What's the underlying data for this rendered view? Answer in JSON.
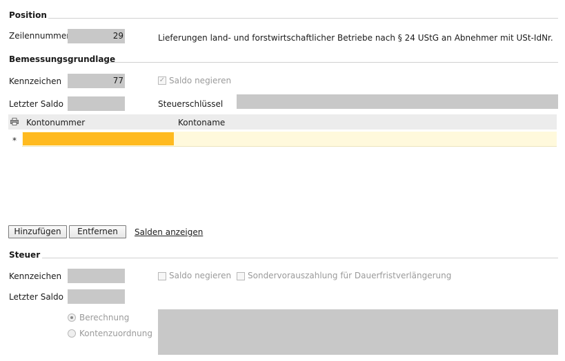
{
  "position": {
    "title": "Position",
    "zeilennummer_label": "Zeilennummer",
    "zeilennummer_value": "29",
    "description": "Lieferungen land- und forstwirtschaftlicher Betriebe nach § 24 UStG an Abnehmer mit USt-IdNr."
  },
  "bemessung": {
    "title": "Bemessungsgrundlage",
    "kennzeichen_label": "Kennzeichen",
    "kennzeichen_value": "77",
    "saldo_negieren_label": "Saldo negieren",
    "saldo_negieren_checked": true,
    "letzter_saldo_label": "Letzter Saldo",
    "letzter_saldo_value": "",
    "steuerschluessel_label": "Steuerschlüssel",
    "steuerschluessel_value": "",
    "table": {
      "columns": [
        "Kontonummer",
        "Kontoname"
      ],
      "new_row_marker": "*",
      "rows": []
    },
    "buttons": {
      "add": "Hinzufügen",
      "remove": "Entfernen",
      "show_balances": "Salden anzeigen"
    }
  },
  "steuer": {
    "title": "Steuer",
    "kennzeichen_label": "Kennzeichen",
    "kennzeichen_value": "",
    "saldo_negieren_label": "Saldo negieren",
    "saldo_negieren_checked": false,
    "sondervorauszahlung_label": "Sondervorauszahlung für Dauerfristverlängerung",
    "sondervorauszahlung_checked": false,
    "letzter_saldo_label": "Letzter Saldo",
    "letzter_saldo_value": "",
    "radio_berechnung": "Berechnung",
    "radio_kontenzuordnung": "Kontenzuordnung",
    "radio_selected": "Berechnung"
  },
  "colors": {
    "field_bg": "#c8c8c8",
    "active_cell": "#ffba1f",
    "new_row_bg": "#fff9dc"
  }
}
